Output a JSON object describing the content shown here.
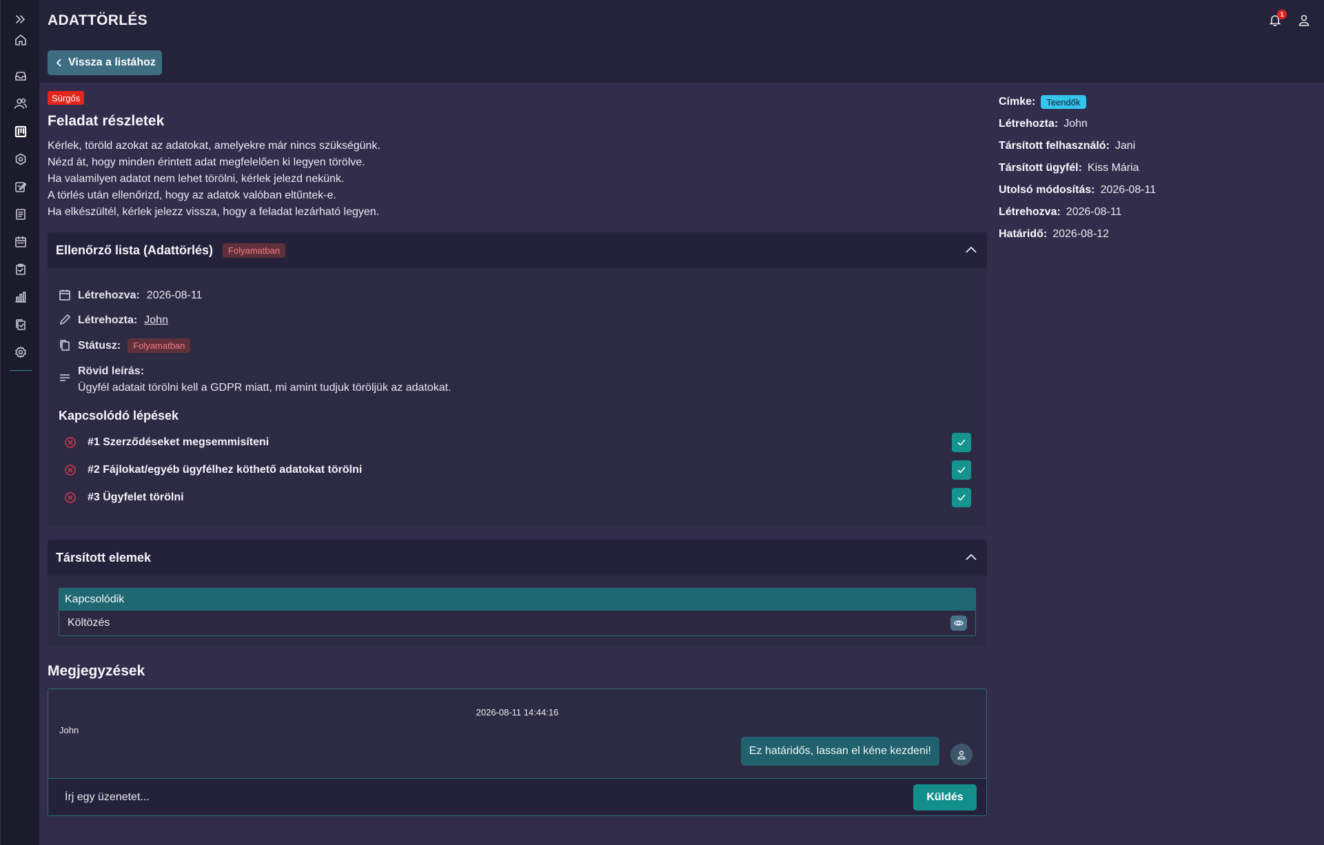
{
  "header": {
    "title": "ADATTÖRLÉS",
    "back_label": "Vissza a listához",
    "notification_count": "1"
  },
  "task": {
    "priority_badge": "Sürgős",
    "details_title": "Feladat részletek",
    "description_lines": [
      "Kérlek, töröld azokat az adatokat, amelyekre már nincs szükségünk.",
      "Nézd át, hogy minden érintett adat megfelelően ki legyen törölve.",
      "Ha valamilyen adatot nem lehet törölni, kérlek jelezd nekünk.",
      "A törlés után ellenőrizd, hogy az adatok valóban eltűntek-e.",
      "Ha elkészültél, kérlek jelezz vissza, hogy a feladat lezárható legyen."
    ]
  },
  "meta": {
    "label_key": "Címke:",
    "label_value": "Teendők",
    "created_by_key": "Létrehozta:",
    "created_by_value": "John",
    "assigned_user_key": "Társított felhasználó:",
    "assigned_user_value": "Jani",
    "assigned_client_key": "Társított ügyfél:",
    "assigned_client_value": "Kiss Mária",
    "modified_key": "Utolsó módosítás:",
    "modified_value": "2026-08-11",
    "created_key": "Létrehozva:",
    "created_value": "2026-08-11",
    "deadline_key": "Határidő:",
    "deadline_value": "2026-08-12"
  },
  "checklist": {
    "title": "Ellenőrző lista (Adattörlés)",
    "status": "Folyamatban",
    "created_key": "Létrehozva:",
    "created_value": "2026-08-11",
    "created_by_key": "Létrehozta:",
    "created_by_value": "John",
    "status_key": "Státusz:",
    "status_value": "Folyamatban",
    "short_desc_key": "Rövid leírás:",
    "short_desc_value": "Ügyfél adatait törölni kell a GDPR miatt, mi amint tudjuk töröljük az adatokat.",
    "steps_title": "Kapcsolódó lépések",
    "steps": [
      {
        "label": "#1 Szerződéseket megsemmisíteni"
      },
      {
        "label": "#2 Fájlokat/egyéb ügyfélhez köthető adatokat törölni"
      },
      {
        "label": "#3 Ügyfelet törölni"
      }
    ]
  },
  "linked": {
    "title": "Társított elemek",
    "header": "Kapcsolódik",
    "rows": [
      {
        "label": "Költözés"
      }
    ]
  },
  "notes": {
    "title": "Megjegyzések",
    "timestamp": "2026-08-11 14:44:16",
    "author": "John",
    "message": "Ez határidős, lassan el kéne kezdeni!",
    "input_placeholder": "Írj egy üzenetet...",
    "send_label": "Küldés"
  },
  "icons": {
    "sidebar": [
      "expand-icon",
      "home-icon",
      "inbox-icon",
      "users-icon",
      "kanban-icon",
      "settings-hex-icon",
      "edit-note-icon",
      "document-icon",
      "calendar-icon",
      "clipboard-check-icon",
      "bar-chart-icon",
      "clipboard-copy-icon",
      "gear-icon"
    ]
  },
  "colors": {
    "urgent": "#e4251d",
    "label_tag": "#34c4ec",
    "accent_teal": "#14948f",
    "status_chip_bg": "#60303a"
  }
}
